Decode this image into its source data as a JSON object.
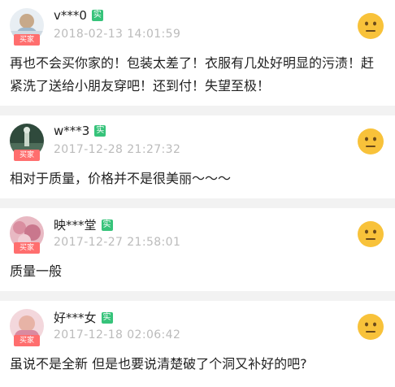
{
  "reviews": [
    {
      "username": "v***0",
      "verified_label": "实",
      "buyer_tag": "买家",
      "date": "2018-02-13 14:01:59",
      "rating_icon": "neutral-face-icon",
      "content": "再也不会买你家的！包装太差了！衣服有几处好明显的污渍！赶紧洗了送给小朋友穿吧！还到付！失望至极！"
    },
    {
      "username": "w***3",
      "verified_label": "实",
      "buyer_tag": "买家",
      "date": "2017-12-28 21:27:32",
      "rating_icon": "neutral-face-icon",
      "content": "相对于质量，价格并不是很美丽～～～"
    },
    {
      "username": "映***堂",
      "verified_label": "实",
      "buyer_tag": "买家",
      "date": "2017-12-27 21:58:01",
      "rating_icon": "neutral-face-icon",
      "content": "质量一般"
    },
    {
      "username": "好***女",
      "verified_label": "实",
      "buyer_tag": "买家",
      "date": "2017-12-18 02:06:42",
      "rating_icon": "neutral-face-icon",
      "content": "虽说不是全新 但是也要说清楚破了个洞又补好的吧?"
    }
  ],
  "colors": {
    "verified": "#36c37a",
    "buyer_tag": "#ff6e6e",
    "face": "#f8c23a",
    "date": "#bbbbbb",
    "separator": "#f2f2f2"
  }
}
